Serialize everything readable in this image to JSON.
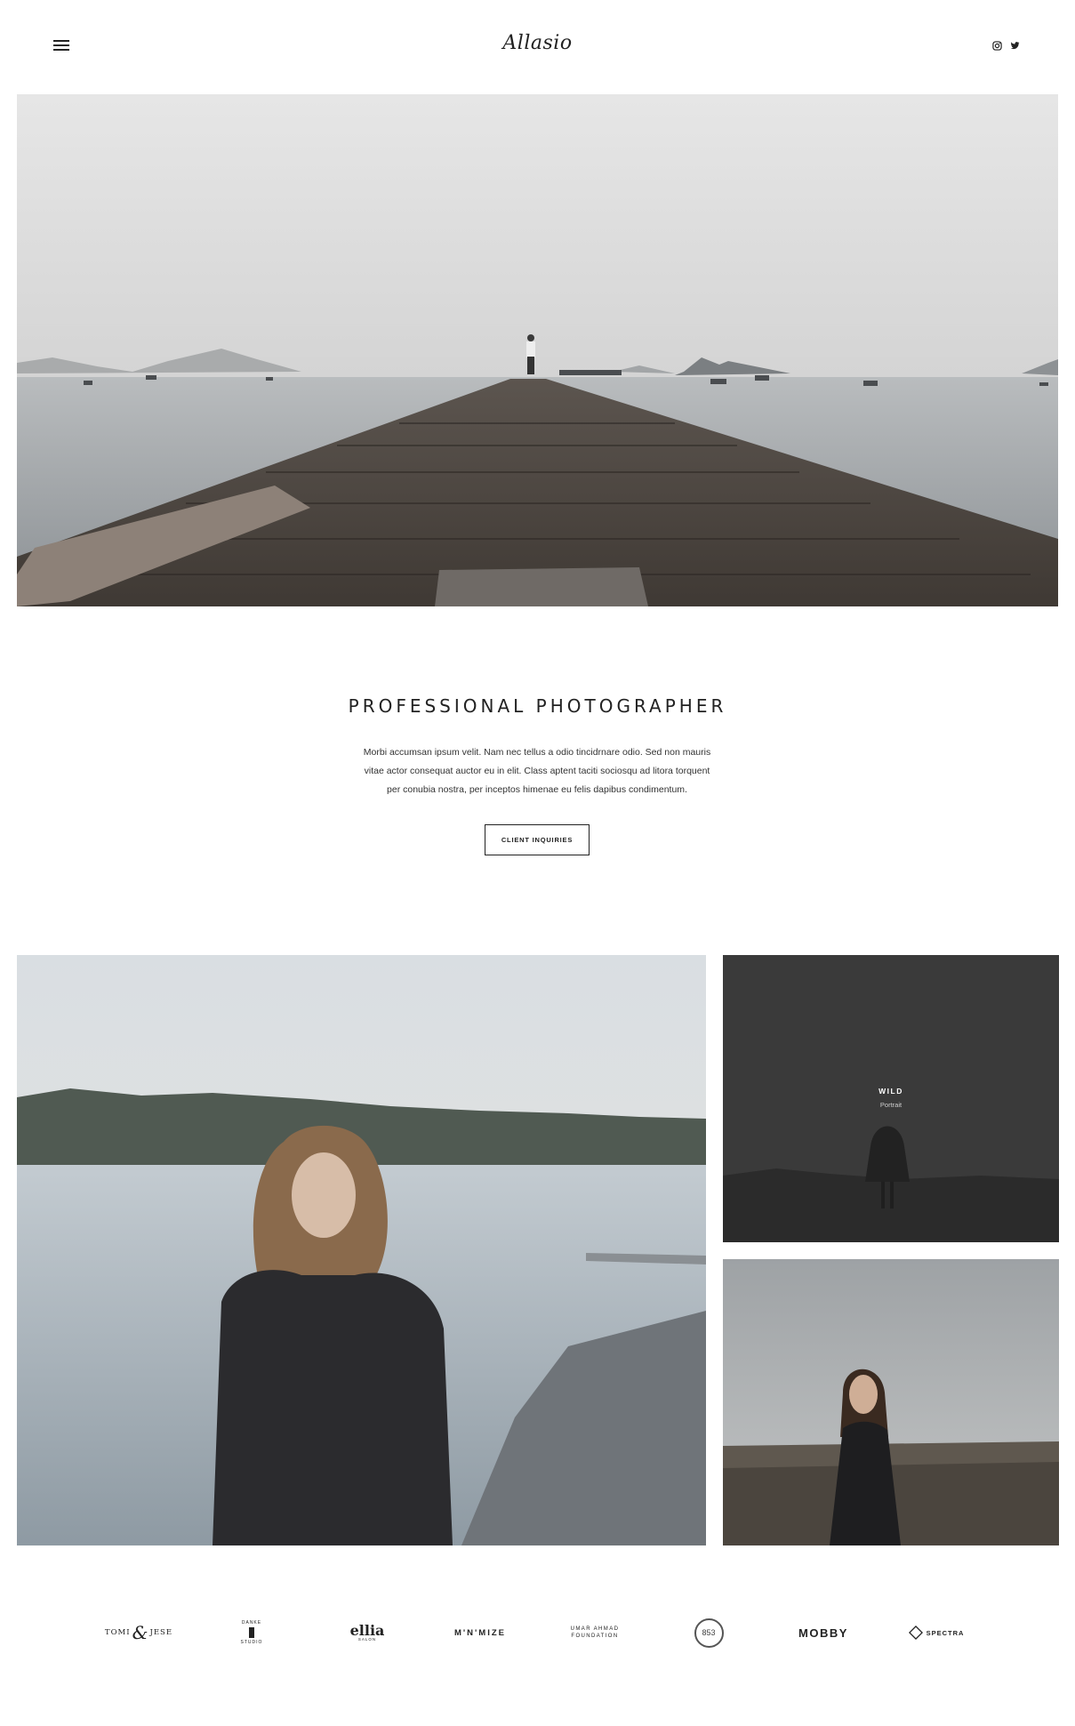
{
  "header": {
    "logo_text": "Allasio",
    "menu_icon": "hamburger-icon",
    "social": [
      "instagram-icon",
      "twitter-icon"
    ]
  },
  "intro": {
    "title": "PROFESSIONAL PHOTOGRAPHER",
    "text": "Morbi accumsan ipsum velit. Nam nec tellus a odio tincidrnare odio. Sed non  mauris vitae actor consequat auctor eu in elit. Class aptent taciti sociosqu ad litora torquent per conubia nostra, per inceptos himenae eu felis dapibus condimentum.",
    "cta_label": "CLIENT INQUIRIES"
  },
  "gallery": {
    "wild": {
      "title": "WILD",
      "subtitle": "Portrait"
    }
  },
  "clients": {
    "tomi_left": "TOMI",
    "tomi_amp": "&",
    "tomi_right": "JESE",
    "danke_top": "DANKE",
    "danke_bottom": "STUDIO",
    "ellia_main": "ellia",
    "ellia_sub": "SALON",
    "minimize": "M'N'MIZE",
    "umar_line1": "UMAR AHMAD",
    "umar_line2": "FOUNDATION",
    "badge": "853",
    "mobby": "MOBBY",
    "spectra": "SPECTRA"
  },
  "colors": {
    "text": "#222222",
    "background": "#ffffff",
    "wild_tile": "#3a3a3a"
  }
}
